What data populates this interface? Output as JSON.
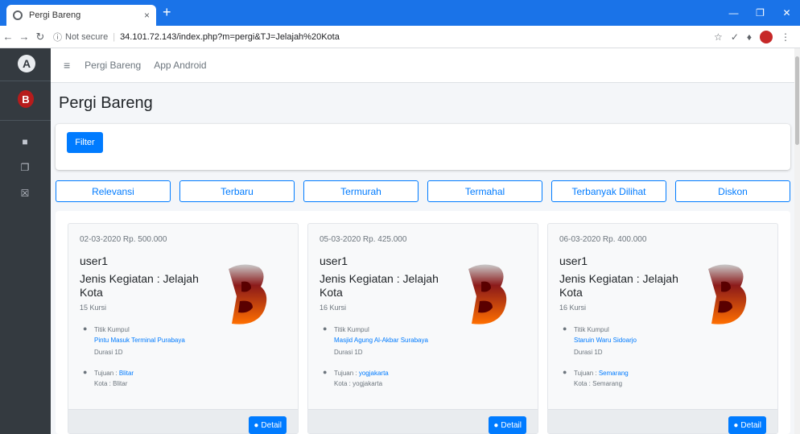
{
  "browser": {
    "tab_title": "Pergi Bareng",
    "tab_close": "×",
    "new_tab": "+",
    "url_prefix": "Not secure",
    "url": "34.101.72.143/index.php?m=pergi&TJ=Jelajah%20Kota"
  },
  "navbar": {
    "menu_icon": "≡",
    "links": [
      "Pergi Bareng",
      "App Android"
    ]
  },
  "page": {
    "title": "Pergi Bareng",
    "filter_label": "Filter"
  },
  "sort_buttons": [
    "Relevansi",
    "Terbaru",
    "Termurah",
    "Termahal",
    "Terbanyak Dilihat",
    "Diskon"
  ],
  "cards": [
    {
      "date_price": "02-03-2020 Rp. 500.000",
      "user": "user1",
      "jenis": "Jenis Kegiatan : Jelajah Kota",
      "kursi": "15 Kursi",
      "titik_label": "Titik Kumpul",
      "titik": "Pintu Masuk Terminal Purabaya",
      "durasi": "Durasi 1D",
      "tujuan_label": "Tujuan :",
      "tujuan": "Blitar",
      "kota": "Kota : Blitar",
      "detail": "Detail"
    },
    {
      "date_price": "05-03-2020 Rp. 425.000",
      "user": "user1",
      "jenis": "Jenis Kegiatan : Jelajah Kota",
      "kursi": "16 Kursi",
      "titik_label": "Titik Kumpul",
      "titik": "Masjid Agung Al-Akbar Surabaya",
      "durasi": "Durasi 1D",
      "tujuan_label": "Tujuan :",
      "tujuan": "yogjakarta",
      "kota": "Kota : yogjakarta",
      "detail": "Detail"
    },
    {
      "date_price": "06-03-2020 Rp. 400.000",
      "user": "user1",
      "jenis": "Jenis Kegiatan : Jelajah Kota",
      "kursi": "16 Kursi",
      "titik_label": "Titik Kumpul",
      "titik": "Staruin Waru Sidoarjo",
      "durasi": "Durasi 1D",
      "tujuan_label": "Tujuan :",
      "tujuan": "Semarang",
      "kota": "Kota : Semarang",
      "detail": "Detail"
    }
  ],
  "colors": {
    "primary": "#007bff",
    "sidebar": "#343a40",
    "browser_bar": "#1a73e8"
  }
}
